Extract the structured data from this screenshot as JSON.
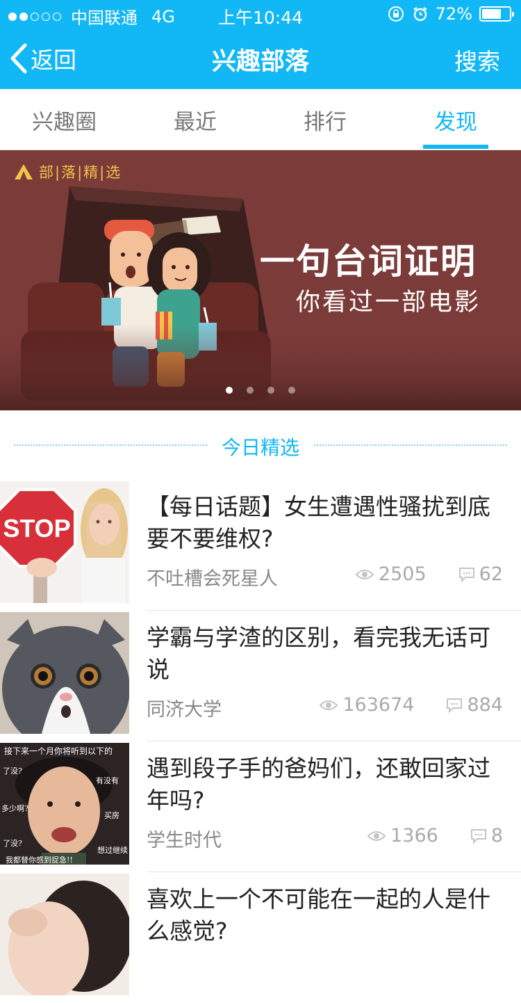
{
  "status_bar": {
    "carrier": "中国联通",
    "network": "4G",
    "time": "上午10:44",
    "battery": "72%",
    "battery_level": 0.72
  },
  "nav": {
    "back_label": "返回",
    "title": "兴趣部落",
    "search_label": "搜索"
  },
  "tabs": [
    {
      "label": "兴趣圈"
    },
    {
      "label": "最近"
    },
    {
      "label": "排行"
    },
    {
      "label": "发现"
    }
  ],
  "active_tab": 3,
  "banner": {
    "badge": "部|落|精|选",
    "line1": "一句台词证明",
    "line2": "你看过一部电影",
    "page_count": 4,
    "current_page": 1
  },
  "section": {
    "title": "今日精选"
  },
  "feed": [
    {
      "title": "【每日话题】女生遭遇性骚扰到底要不要维权?",
      "source": "不吐槽会死星人",
      "views": "2505",
      "comments": "62",
      "thumb_text": "STOP"
    },
    {
      "title": "学霸与学渣的区别，看完我无话可说",
      "source": "同济大学",
      "views": "163674",
      "comments": "884"
    },
    {
      "title": "遇到段子手的爸妈们，还敢回家过年吗?",
      "source": "学生时代",
      "views": "1366",
      "comments": "8"
    },
    {
      "title": "喜欢上一个不可能在一起的人是什么感觉?",
      "source": "",
      "views": "",
      "comments": ""
    }
  ],
  "colors": {
    "accent": "#12b7f5",
    "banner_bg": "#7b3b39",
    "badge": "#f5c24a"
  }
}
